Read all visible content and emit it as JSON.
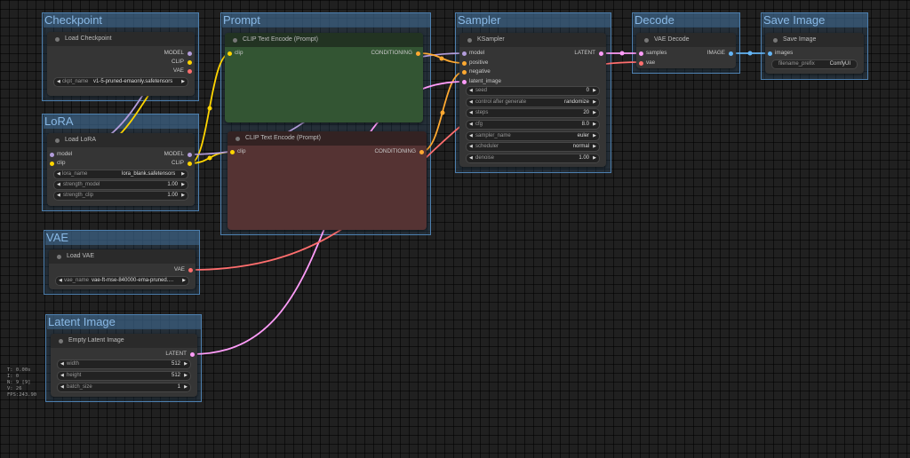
{
  "groups": {
    "checkpoint": "Checkpoint",
    "lora": "LoRA",
    "vae": "VAE",
    "latent": "Latent Image",
    "prompt": "Prompt",
    "sampler": "Sampler",
    "decode": "Decode",
    "save": "Save Image"
  },
  "nodes": {
    "load_checkpoint": {
      "title": "Load Checkpoint",
      "outputs": [
        "MODEL",
        "CLIP",
        "VAE"
      ],
      "ckpt_name": {
        "label": "ckpt_name",
        "value": "v1-5-pruned-emaonly.safetensors"
      }
    },
    "load_lora": {
      "title": "Load LoRA",
      "inputs": [
        "model",
        "clip"
      ],
      "outputs": [
        "MODEL",
        "CLIP"
      ],
      "lora_name": {
        "label": "lora_name",
        "value": "lora_blank.safetensors"
      },
      "strength_model": {
        "label": "strength_model",
        "value": "1.00"
      },
      "strength_clip": {
        "label": "strength_clip",
        "value": "1.00"
      }
    },
    "load_vae": {
      "title": "Load VAE",
      "outputs": [
        "VAE"
      ],
      "vae_name": {
        "label": "vae_name",
        "value": "vae-ft-mse-840000-ema-pruned.safetensors"
      }
    },
    "empty_latent": {
      "title": "Empty Latent Image",
      "outputs": [
        "LATENT"
      ],
      "width": {
        "label": "width",
        "value": "512"
      },
      "height": {
        "label": "height",
        "value": "512"
      },
      "batch_size": {
        "label": "batch_size",
        "value": "1"
      }
    },
    "clip_pos": {
      "title": "CLIP Text Encode (Prompt)",
      "inputs": [
        "clip"
      ],
      "outputs": [
        "CONDITIONING"
      ]
    },
    "clip_neg": {
      "title": "CLIP Text Encode (Prompt)",
      "inputs": [
        "clip"
      ],
      "outputs": [
        "CONDITIONING"
      ]
    },
    "ksampler": {
      "title": "KSampler",
      "inputs": [
        "model",
        "positive",
        "negative",
        "latent_image"
      ],
      "outputs": [
        "LATENT"
      ],
      "widgets": [
        {
          "label": "seed",
          "value": "0"
        },
        {
          "label": "control after generate",
          "value": "randomize"
        },
        {
          "label": "steps",
          "value": "20"
        },
        {
          "label": "cfg",
          "value": "8.0"
        },
        {
          "label": "sampler_name",
          "value": "euler"
        },
        {
          "label": "scheduler",
          "value": "normal"
        },
        {
          "label": "denoise",
          "value": "1.00"
        }
      ]
    },
    "vae_decode": {
      "title": "VAE Decode",
      "inputs": [
        "samples",
        "vae"
      ],
      "outputs": [
        "IMAGE"
      ]
    },
    "save_image": {
      "title": "Save Image",
      "inputs": [
        "images"
      ],
      "filename_prefix": {
        "label": "filename_prefix",
        "value": "ComfyUI"
      }
    }
  },
  "stats": [
    "T: 0.00s",
    "I: 0",
    "N: 9 [9]",
    "V: 26",
    "FPS:243.90"
  ],
  "colors": {
    "model": "#b39ddb",
    "clip": "#ffd500",
    "vae": "#ff6e6e",
    "conditioning": "#ffa931",
    "latent": "#ff9cf9",
    "image": "#64b5f6",
    "group": "#335577"
  },
  "icons": {
    "status_dot": "circle-dot",
    "arrow_left": "left-triangle",
    "arrow_right": "right-triangle"
  }
}
